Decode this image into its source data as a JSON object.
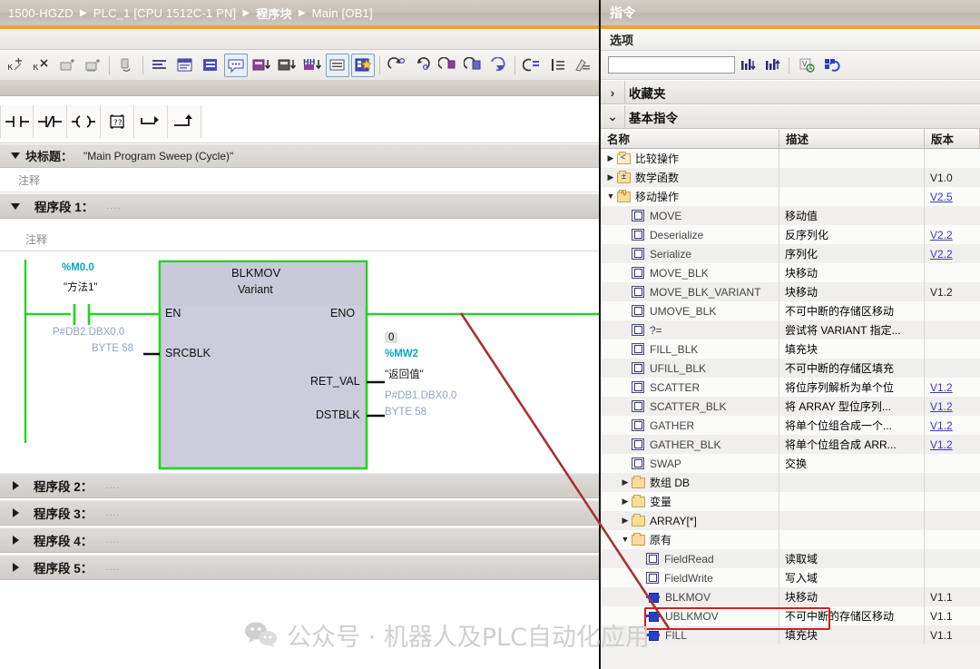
{
  "breadcrumb": {
    "items": [
      {
        "label": "1500-HGZD",
        "bold": false
      },
      {
        "label": "PLC_1 [CPU 1512C-1 PN]",
        "bold": false
      },
      {
        "label": "程序块",
        "bold": true
      },
      {
        "label": "Main [OB1]",
        "bold": false
      }
    ]
  },
  "toolbar": {
    "icons": [
      "insert-network-icon",
      "delete-network-icon",
      "upload-block-icon",
      "download-block-icon",
      "monitor-toggle-icon",
      "show-hide-absolute-icon",
      "comments-on-icon",
      "network-comments-icon",
      "balloon-comment-icon",
      "download-to-device-icon",
      "upload-from-device-icon",
      "compare-blocks-icon",
      "collapse-networks-icon",
      "favorites-icon",
      "goto-next-icon",
      "goto-prev-icon",
      "goto-error-icon",
      "goto-error2-icon",
      "update-inconsistent-icon",
      "jump-label-icon",
      "network-overview-icon",
      "marker-icon"
    ],
    "lad_elements": [
      {
        "name": "normally-open-contact",
        "label": "-| |-"
      },
      {
        "name": "normally-closed-contact",
        "label": "-|/|-"
      },
      {
        "name": "output-coil",
        "label": "-( )-"
      },
      {
        "name": "empty-box",
        "label": "??"
      },
      {
        "name": "open-branch",
        "label": "branch"
      },
      {
        "name": "close-branch",
        "label": "close-branch"
      }
    ]
  },
  "block": {
    "title_label": "块标题：",
    "title_value": "\"Main Program Sweep (Cycle)\"",
    "comment": "注释"
  },
  "networks": [
    {
      "id": "net1",
      "label": "程序段 1：",
      "dots": "....",
      "comment": "注释",
      "expanded": true
    },
    {
      "id": "net2",
      "label": "程序段 2：",
      "dots": "....",
      "expanded": false
    },
    {
      "id": "net3",
      "label": "程序段 3：",
      "dots": "....",
      "expanded": false
    },
    {
      "id": "net4",
      "label": "程序段 4：",
      "dots": "....",
      "expanded": false
    },
    {
      "id": "net5",
      "label": "程序段 5：",
      "dots": "....",
      "expanded": false
    }
  ],
  "lad": {
    "contact": {
      "address": "%M0.0",
      "symbol": "\"方法1\""
    },
    "box": {
      "name": "BLKMOV",
      "subtitle": "Variant",
      "pins_left": [
        "EN",
        "SRCBLK"
      ],
      "pins_right": [
        "ENO",
        "RET_VAL",
        "DSTBLK"
      ]
    },
    "src_operand": {
      "line1": "P#DB2.DBX0.0",
      "line2": "BYTE 58"
    },
    "retval_operand": {
      "value": "0",
      "address": "%MW2",
      "symbol": "\"返回值\""
    },
    "dst_operand": {
      "line1": "P#DB1.DBX0.0",
      "line2": "BYTE 58"
    },
    "colors": {
      "rail": "#22d422",
      "box_fill": "#ccccdd",
      "box_header": "#c5c5d8",
      "address": "#0aa7c2",
      "operand": "#8fa4c6"
    }
  },
  "instructions_panel": {
    "title": "指令",
    "options_label": "选项",
    "search_value": "",
    "search_placeholder": "",
    "search_icons": [
      "find-down-icon",
      "find-up-icon",
      "filter-icon",
      "sync-icon"
    ],
    "accordions": [
      {
        "label": "收藏夹",
        "expanded": false
      },
      {
        "label": "基本指令",
        "expanded": true
      }
    ],
    "columns": [
      "名称",
      "描述",
      "版本"
    ],
    "rows": [
      {
        "indent": 0,
        "twisty": "right",
        "icon": "folder-compare",
        "name": "比较操作",
        "desc": "",
        "version": "",
        "version_link": false
      },
      {
        "indent": 0,
        "twisty": "right",
        "icon": "folder-math",
        "name": "数学函数",
        "desc": "",
        "version": "V1.0",
        "version_link": false
      },
      {
        "indent": 0,
        "twisty": "down",
        "icon": "folder-move",
        "name": "移动操作",
        "desc": "",
        "version": "V2.5",
        "version_link": true
      },
      {
        "indent": 1,
        "twisty": "",
        "icon": "instr-box",
        "name": "MOVE",
        "desc": "移动值",
        "version": "",
        "version_link": false
      },
      {
        "indent": 1,
        "twisty": "",
        "icon": "instr-box",
        "name": "Deserialize",
        "desc": "反序列化",
        "version": "V2.2",
        "version_link": true
      },
      {
        "indent": 1,
        "twisty": "",
        "icon": "instr-box",
        "name": "Serialize",
        "desc": "序列化",
        "version": "V2.2",
        "version_link": true
      },
      {
        "indent": 1,
        "twisty": "",
        "icon": "instr-box",
        "name": "MOVE_BLK",
        "desc": "块移动",
        "version": "",
        "version_link": false
      },
      {
        "indent": 1,
        "twisty": "",
        "icon": "instr-box",
        "name": "MOVE_BLK_VARIANT",
        "desc": "块移动",
        "version": "V1.2",
        "version_link": false
      },
      {
        "indent": 1,
        "twisty": "",
        "icon": "instr-box",
        "name": "UMOVE_BLK",
        "desc": "不可中断的存储区移动",
        "version": "",
        "version_link": false
      },
      {
        "indent": 1,
        "twisty": "",
        "icon": "instr-box",
        "name": "?=",
        "desc": "尝试将 VARIANT 指定...",
        "version": "",
        "version_link": false
      },
      {
        "indent": 1,
        "twisty": "",
        "icon": "instr-box",
        "name": "FILL_BLK",
        "desc": "填充块",
        "version": "",
        "version_link": false
      },
      {
        "indent": 1,
        "twisty": "",
        "icon": "instr-box",
        "name": "UFILL_BLK",
        "desc": "不可中断的存储区填充",
        "version": "",
        "version_link": false
      },
      {
        "indent": 1,
        "twisty": "",
        "icon": "instr-box",
        "name": "SCATTER",
        "desc": "将位序列解析为单个位",
        "version": "V1.2",
        "version_link": true
      },
      {
        "indent": 1,
        "twisty": "",
        "icon": "instr-box",
        "name": "SCATTER_BLK",
        "desc": "将 ARRAY 型位序列...",
        "version": "V1.2",
        "version_link": true
      },
      {
        "indent": 1,
        "twisty": "",
        "icon": "instr-box",
        "name": "GATHER",
        "desc": "将单个位组合成一个...",
        "version": "V1.2",
        "version_link": true
      },
      {
        "indent": 1,
        "twisty": "",
        "icon": "instr-box",
        "name": "GATHER_BLK",
        "desc": "将单个位组合成 ARR...",
        "version": "V1.2",
        "version_link": true
      },
      {
        "indent": 1,
        "twisty": "",
        "icon": "instr-box",
        "name": "SWAP",
        "desc": "交换",
        "version": "",
        "version_link": false
      },
      {
        "indent": 1,
        "twisty": "right",
        "icon": "folder",
        "name": "数组 DB",
        "desc": "",
        "version": "",
        "version_link": false
      },
      {
        "indent": 1,
        "twisty": "right",
        "icon": "folder",
        "name": "变量",
        "desc": "",
        "version": "",
        "version_link": false
      },
      {
        "indent": 1,
        "twisty": "right",
        "icon": "folder",
        "name": "ARRAY[*]",
        "desc": "",
        "version": "",
        "version_link": false
      },
      {
        "indent": 1,
        "twisty": "down",
        "icon": "folder",
        "name": "原有",
        "desc": "",
        "version": "",
        "version_link": false
      },
      {
        "indent": 2,
        "twisty": "",
        "icon": "instr-box",
        "name": "FieldRead",
        "desc": "读取域",
        "version": "",
        "version_link": false
      },
      {
        "indent": 2,
        "twisty": "",
        "icon": "instr-box",
        "name": "FieldWrite",
        "desc": "写入域",
        "version": "",
        "version_link": false
      },
      {
        "indent": 2,
        "twisty": "",
        "icon": "legacy-box",
        "name": "BLKMOV",
        "desc": "块移动",
        "version": "V1.1",
        "version_link": false
      },
      {
        "indent": 2,
        "twisty": "",
        "icon": "legacy-box",
        "name": "UBLKMOV",
        "desc": "不可中断的存储区移动",
        "version": "V1.1",
        "version_link": false
      },
      {
        "indent": 2,
        "twisty": "",
        "icon": "legacy-box",
        "name": "FILL",
        "desc": "填充块",
        "version": "V1.1",
        "version_link": false
      }
    ]
  },
  "annotation": {
    "highlight_color": "#d02020",
    "line_color": "#a83232",
    "highlighted_row": "BLKMOV"
  },
  "watermark": {
    "text": "公众号 · 机器人及PLC自动化应用"
  }
}
